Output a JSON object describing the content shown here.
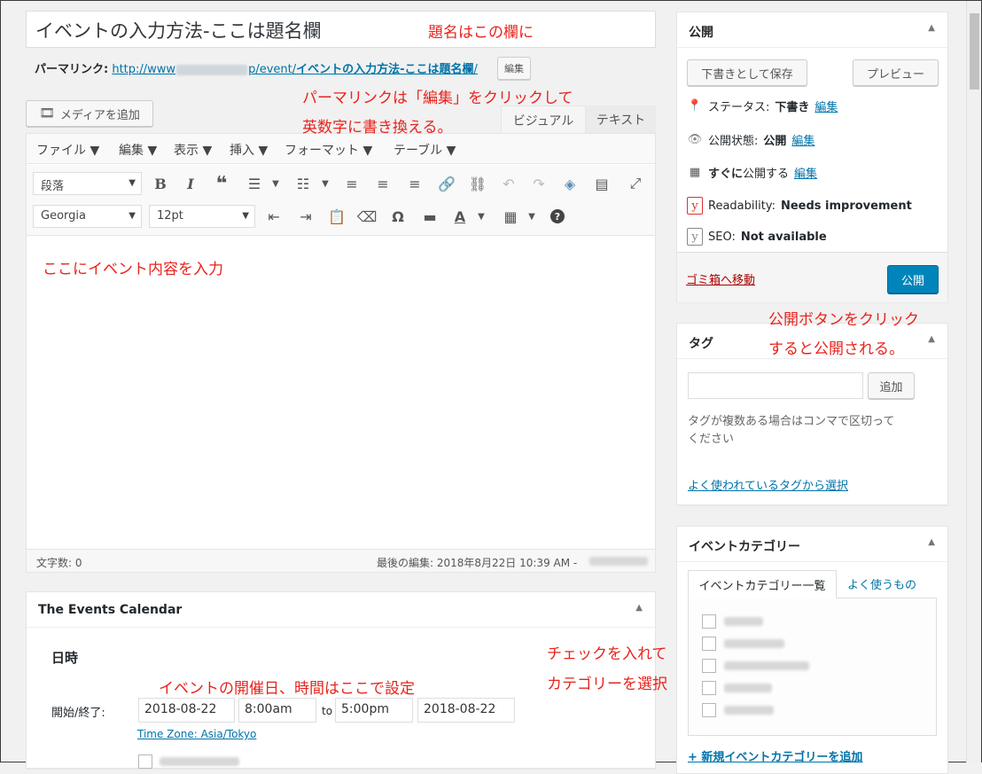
{
  "post": {
    "title": "イベントの入力方法-ここは題名欄",
    "permalink_label": "パーマリンク:",
    "permalink_prefix": "http://www",
    "permalink_mid": "p/event/",
    "permalink_slug": "イベントの入力方法-ここは題名欄",
    "permalink_suffix": "/",
    "edit_slug_label": "編集"
  },
  "editor": {
    "add_media_label": "メディアを追加",
    "tab_visual": "ビジュアル",
    "tab_text": "テキスト",
    "menu": [
      "ファイル ▼",
      "編集 ▼",
      "表示 ▼",
      "挿入 ▼",
      "フォーマット ▼",
      "テーブル ▼"
    ],
    "format_select": "段落",
    "font_select": "Georgia",
    "size_select": "12pt",
    "content": "ここにイベント内容を入力",
    "word_count": "文字数: 0",
    "last_edited": "最後の編集: 2018年8月22日 10:39 AM -"
  },
  "events_calendar": {
    "title": "The Events Calendar",
    "section": "日時",
    "start_end_label": "開始/終了:",
    "start_date": "2018-08-22",
    "start_time": "8:00am",
    "to_label": "to",
    "end_time": "5:00pm",
    "end_date": "2018-08-22",
    "timezone": "Time Zone: Asia/Tokyo"
  },
  "publish": {
    "title": "公開",
    "save_draft": "下書きとして保存",
    "preview": "プレビュー",
    "status_label": "ステータス:",
    "status_value": "下書き",
    "visibility_label": "公開状態:",
    "visibility_value": "公開",
    "schedule_value": "すぐに",
    "schedule_label": "公開する",
    "edit_link": "編集",
    "readability_label": "Readability:",
    "readability_value": "Needs improvement",
    "seo_label": "SEO:",
    "seo_value": "Not available",
    "trash_link": "ゴミ箱へ移動",
    "publish_button": "公開"
  },
  "tags": {
    "title": "タグ",
    "add_button": "追加",
    "help": "タグが複数ある場合はコンマで区切ってください",
    "help_line1": "タグが複数ある場合はコンマで区切って",
    "help_line2": "ください",
    "choose_link": "よく使われているタグから選択"
  },
  "event_categories": {
    "title": "イベントカテゴリー",
    "tab_all": "イベントカテゴリー一覧",
    "tab_popular": "よく使うもの",
    "add_new_link": "+ 新規イベントカテゴリーを追加"
  },
  "annotations": {
    "title_note": "題名はこの欄に",
    "permalink_note_1": "パーマリンクは「編集」をクリックして",
    "permalink_note_2": "英数字に書き換える。",
    "publish_note_1": "公開ボタンをクリック",
    "publish_note_2": "すると公開される。",
    "datetime_note": "イベントの開催日、時間はここで設定",
    "category_note_1": "チェックを入れて",
    "category_note_2": "カテゴリーを選択"
  },
  "colors": {
    "annotation": "#e8231c",
    "link": "#0073aa",
    "primary_button": "#0085ba",
    "trash": "#a00"
  }
}
